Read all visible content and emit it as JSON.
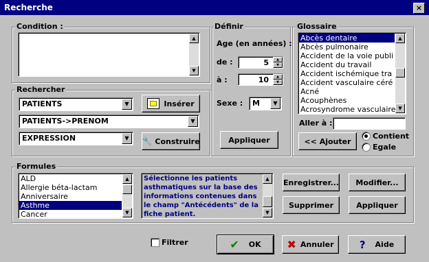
{
  "window": {
    "title": "Recherche",
    "close_label": "×"
  },
  "condition": {
    "label": "Condition :",
    "value": ""
  },
  "rechercher": {
    "label": "Rechercher",
    "combo1": "PATIENTS",
    "combo2": "PATIENTS->PRENOM",
    "combo3": "EXPRESSION",
    "inserer_label": "Insérer",
    "construire_label": "Construire"
  },
  "definir": {
    "label": "Définir",
    "age_label": "Age (en années) :",
    "de_label": "de :",
    "de_value": "5",
    "a_label": "à :",
    "a_value": "10",
    "sexe_label": "Sexe :",
    "sexe_value": "M",
    "appliquer_label": "Appliquer"
  },
  "glossaire": {
    "label": "Glossaire",
    "items": [
      "Abcès dentaire",
      "Abcès pulmonaire",
      "Accident de la voie publi",
      "Accident du travail",
      "Accident ischémique tra",
      "Accident vasculaire céré",
      "Acné",
      "Acouphènes",
      "Acrosyndrome vasculaire"
    ],
    "selected_index": 0,
    "aller_label": "Aller à :",
    "aller_value": "",
    "ajouter_label": "<< Ajouter",
    "contient_label": "Contient",
    "egale_label": "Egale",
    "selected_option": "Contient"
  },
  "formules": {
    "label": "Formules",
    "items": [
      "ALD",
      "Allergie béta-lactam",
      "Anniversaire",
      "Asthme",
      "Cancer"
    ],
    "selected_index": 3,
    "description": "Sélectionne les patients asthmatiques sur la base des informations contenues dans le champ \"Antécédents\" de la fiche patient.",
    "enregistrer_label": "Enregistrer...",
    "modifier_label": "Modifier...",
    "supprimer_label": "Supprimer",
    "appliquer_label": "Appliquer"
  },
  "footer": {
    "filtrer_label": "Filtrer",
    "ok_label": "OK",
    "annuler_label": "Annuler",
    "aide_label": "Aide"
  },
  "colors": {
    "titlebar": "#000080",
    "selection": "#000080",
    "description_text": "#000080"
  }
}
